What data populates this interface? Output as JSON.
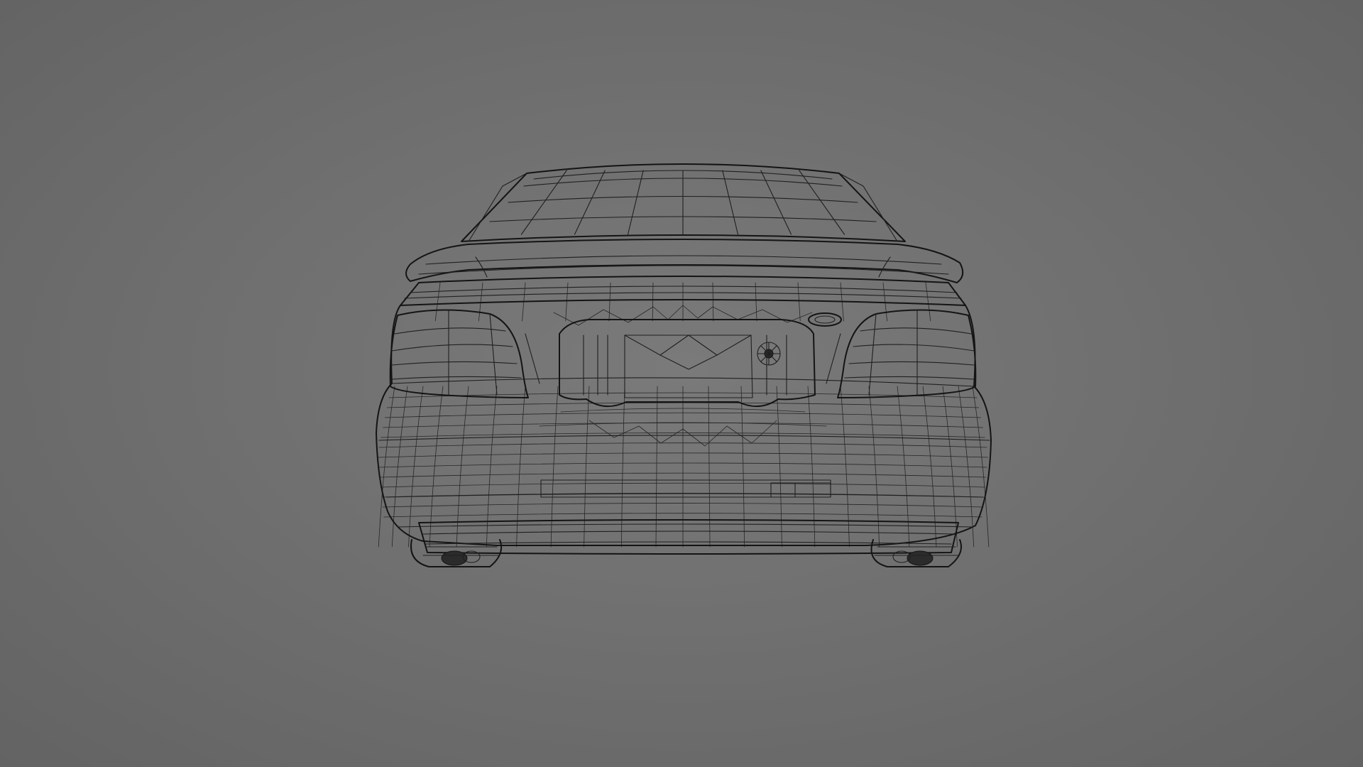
{
  "scene": {
    "background_color": "#707070",
    "wire_color": "#1f1f1f",
    "subject": "car-rear-wireframe"
  }
}
